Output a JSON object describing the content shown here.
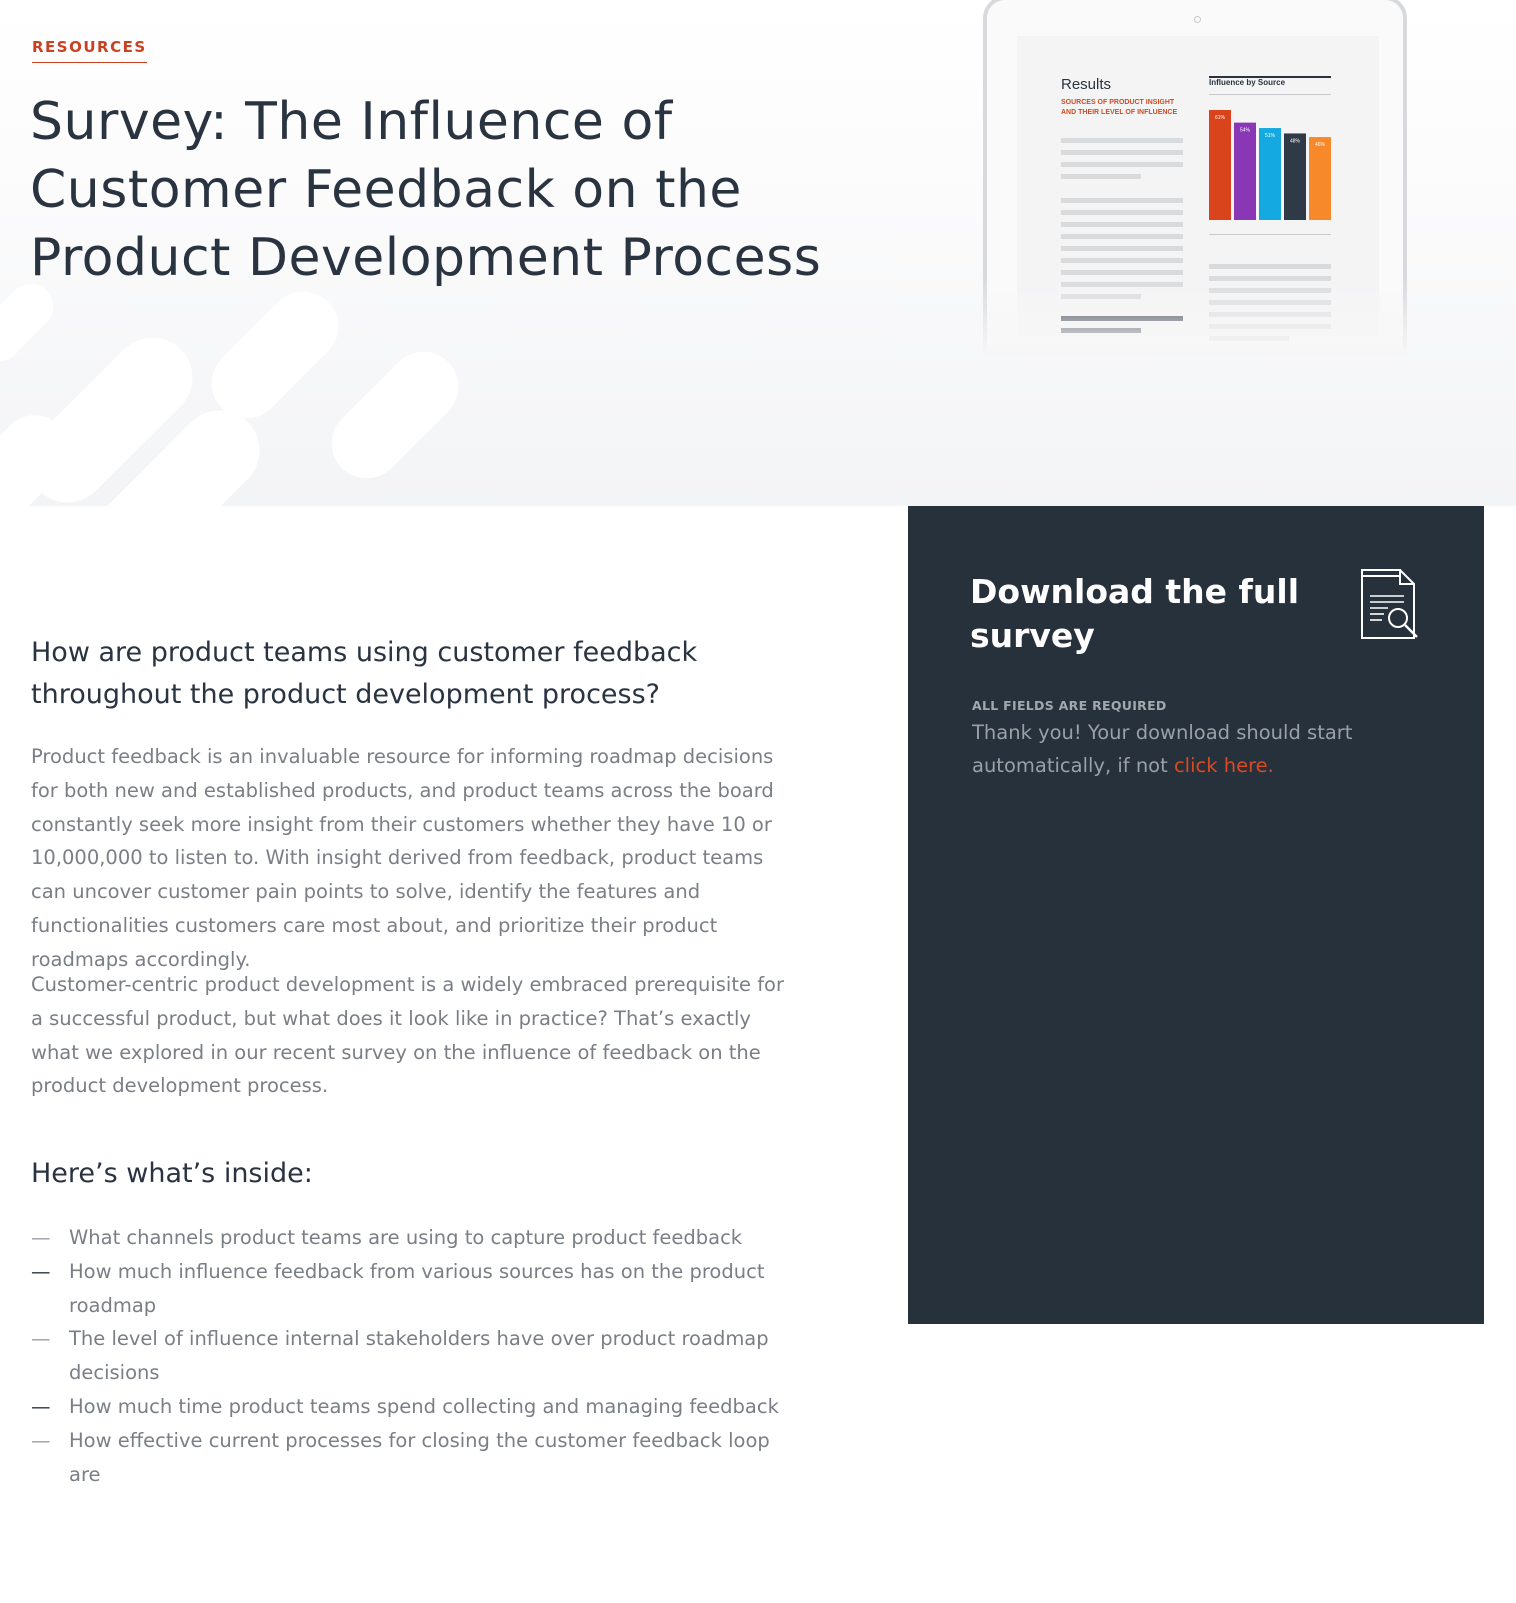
{
  "hero": {
    "eyebrow": "RESOURCES",
    "title": "Survey: The Influence of Customer Feedback on the Product Development Process"
  },
  "preview": {
    "results_heading": "Results",
    "results_subheading": "SOURCES OF PRODUCT INSIGHT AND THEIR LEVEL OF INFLUENCE",
    "chart_title": "Influence by Source"
  },
  "chart_data": {
    "type": "bar",
    "title": "Influence by Source",
    "categories": [
      "",
      "",
      "",
      "",
      ""
    ],
    "values": [
      61,
      54,
      51,
      48,
      46
    ],
    "labels": [
      "61%",
      "54%",
      "51%",
      "48%",
      "46%"
    ],
    "colors": [
      "#d9441c",
      "#8a37b5",
      "#14a9e0",
      "#2f3a47",
      "#f7892b"
    ],
    "ylim": [
      0,
      61
    ]
  },
  "main": {
    "heading": "How are product teams using customer feedback throughout the product development process?",
    "paragraph_1": "Product feedback is an invaluable resource for informing roadmap decisions for both new and established products, and product teams across the board constantly seek more insight from their customers whether they have 10 or 10,000,000 to listen to. With insight derived from feedback, product teams can uncover customer pain points to solve, identify the features and functionalities customers care most about, and prioritize their product roadmaps accordingly.",
    "paragraph_2": "Customer-centric product development is a widely embraced prerequisite for a successful product, but what does it look like in practice? That’s exactly what we explored in our recent survey on the influence of feedback on the product development process.",
    "inside_heading": "Here’s what’s inside:",
    "inside_items": [
      {
        "dash": "—",
        "text": "What channels product teams are using to capture product feedback"
      },
      {
        "dash": "—",
        "text": "How much influence feedback from various sources has on the product roadmap"
      },
      {
        "dash": "—",
        "text": "The level of influence internal stakeholders have over product roadmap decisions"
      },
      {
        "dash": "—",
        "text": "How much time product teams spend collecting and managing feedback"
      },
      {
        "dash": "—",
        "text": "How effective current processes for closing the customer feedback loop are"
      }
    ]
  },
  "download": {
    "title": "Download the full survey",
    "fields_note": "ALL FIELDS ARE REQUIRED",
    "thanks_text": "Thank you! Your download should start automatically, if not ",
    "link_text": "click here.",
    "icon": "document-search-icon"
  },
  "colors": {
    "accent": "#c94120",
    "panel_bg": "#27313c",
    "heading": "#2a3340",
    "body_text": "#7a7e85"
  }
}
